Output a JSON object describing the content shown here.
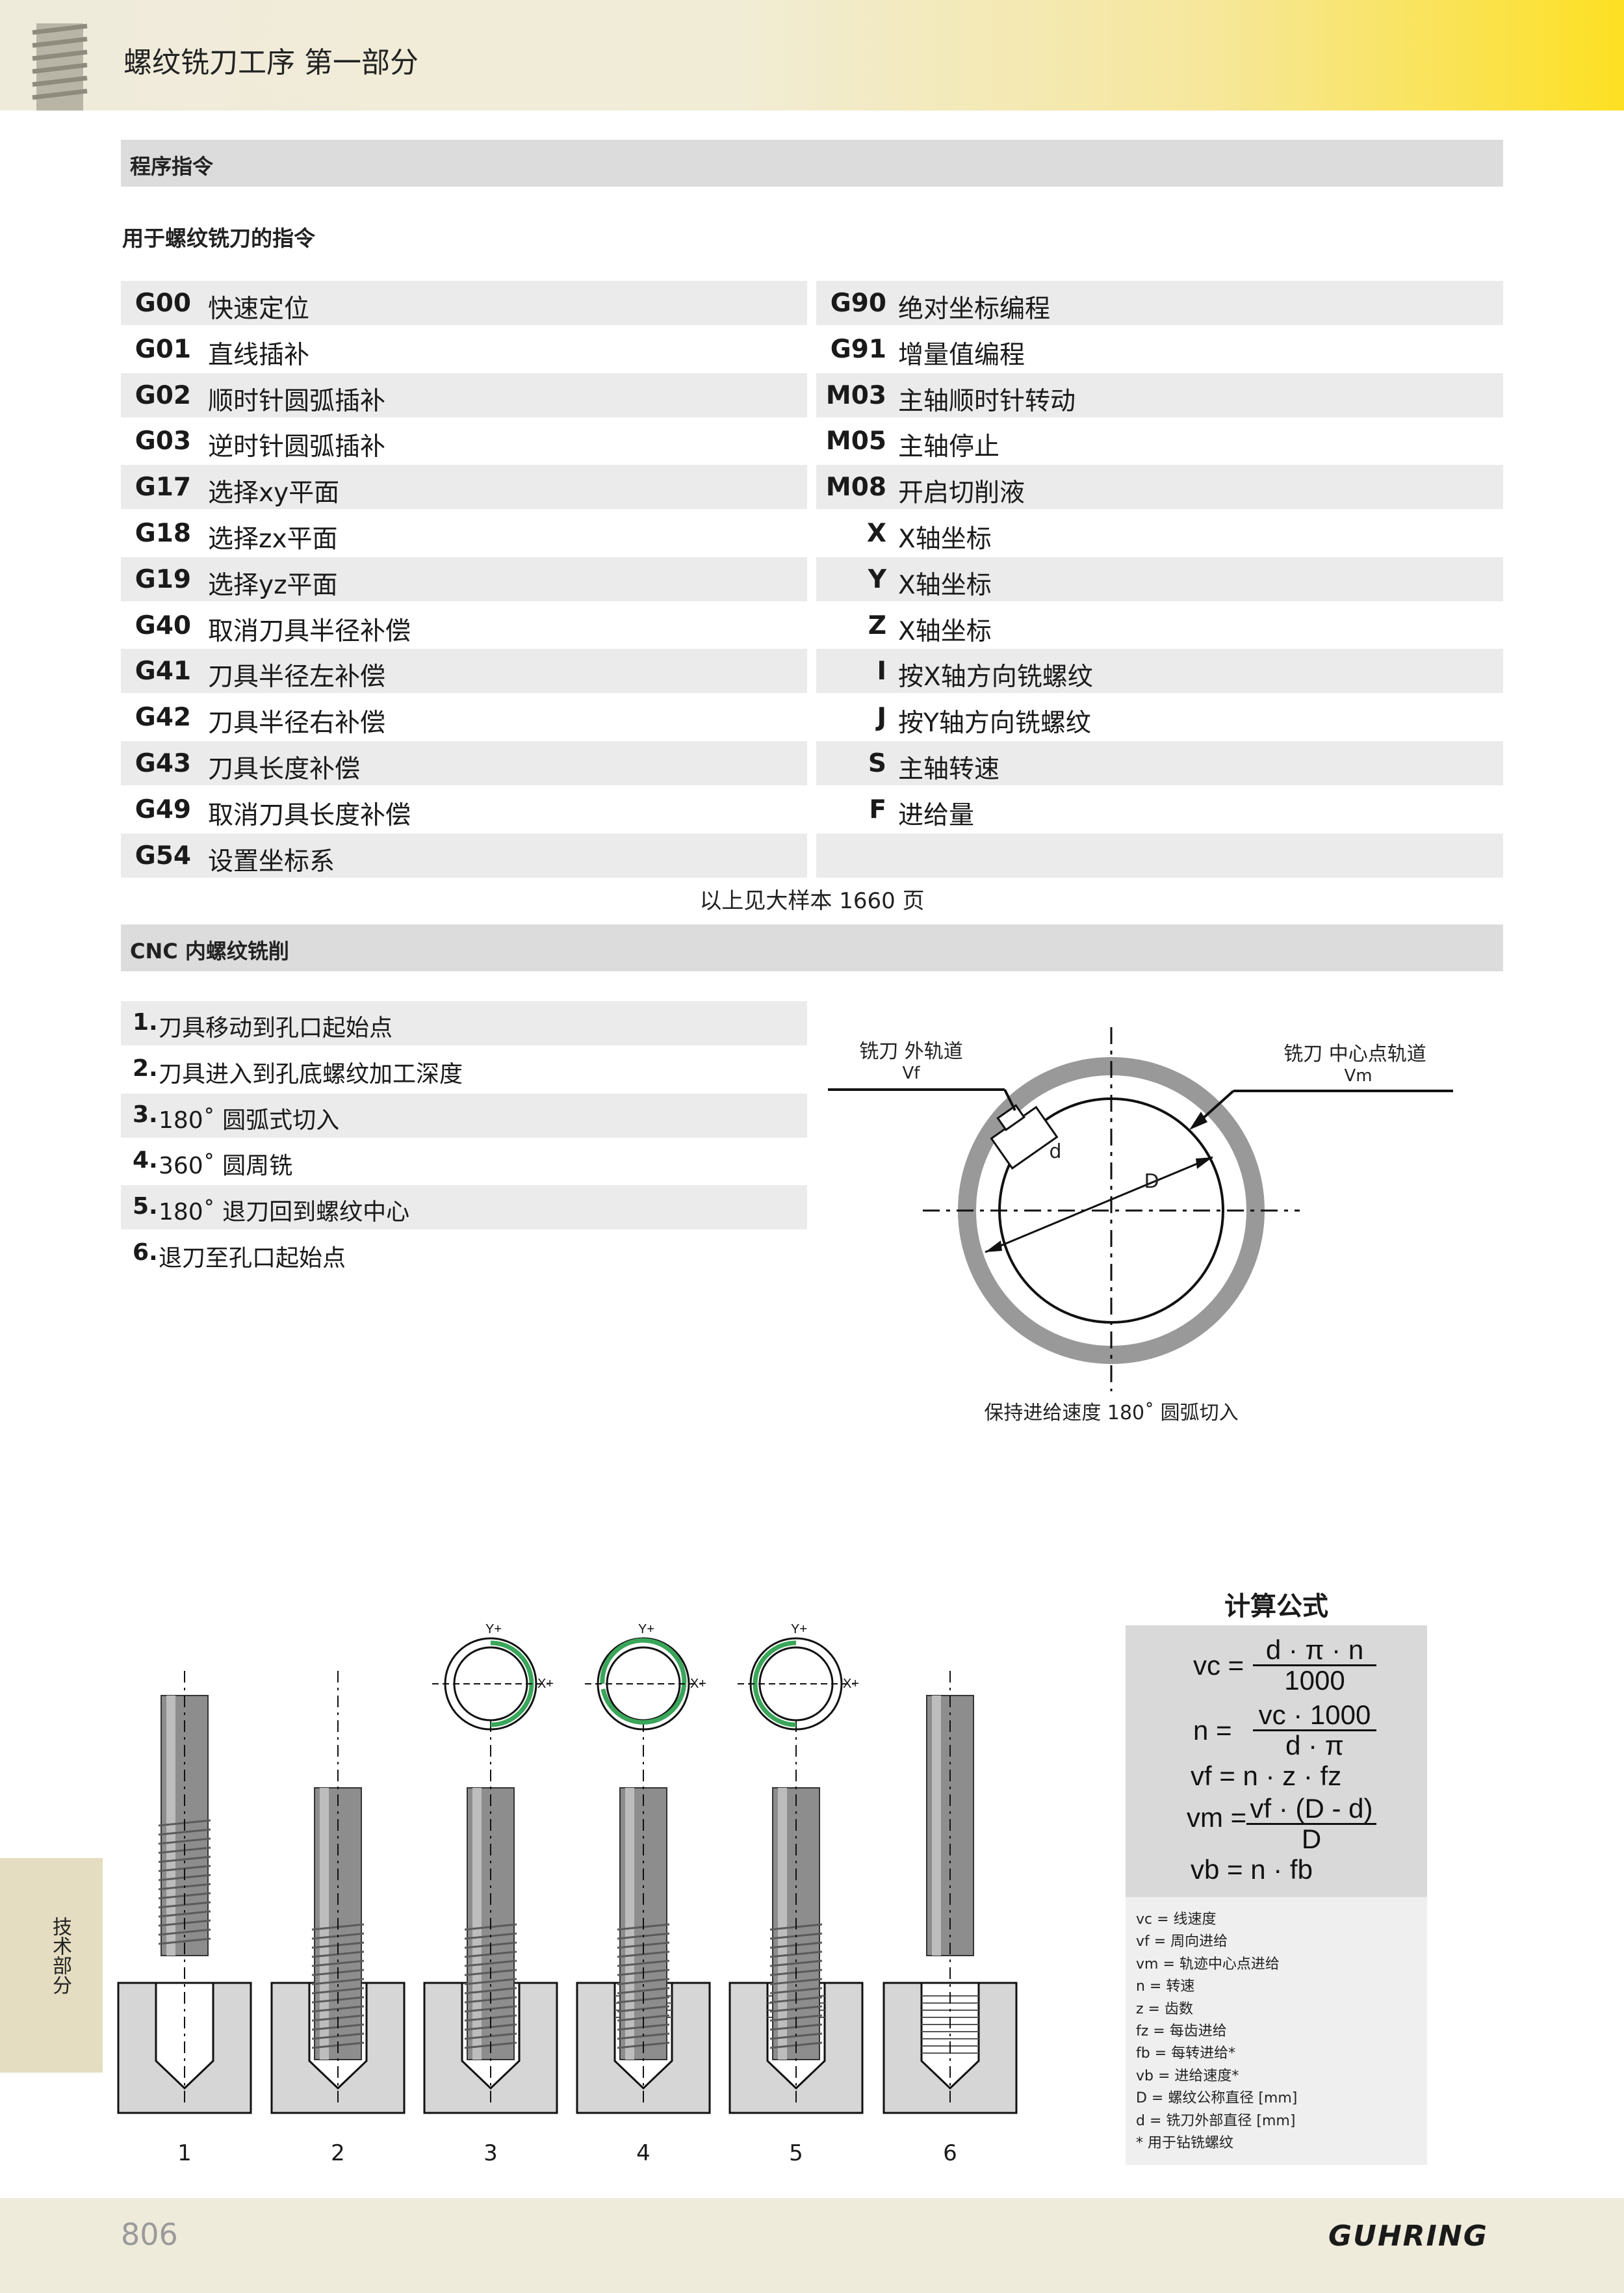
{
  "header": {
    "title": "螺纹铣刀工序   第一部分"
  },
  "section1": {
    "title": "程序指令",
    "subtitle": "用于螺纹铣刀的指令"
  },
  "commands_left": [
    {
      "code": "G00",
      "desc": "快速定位"
    },
    {
      "code": "G01",
      "desc": "直线插补"
    },
    {
      "code": "G02",
      "desc": "顺时针圆弧插补"
    },
    {
      "code": "G03",
      "desc": "逆时针圆弧插补"
    },
    {
      "code": "G17",
      "desc": "选择xy平面"
    },
    {
      "code": "G18",
      "desc": "选择zx平面"
    },
    {
      "code": "G19",
      "desc": "选择yz平面"
    },
    {
      "code": "G40",
      "desc": "取消刀具半径补偿"
    },
    {
      "code": "G41",
      "desc": "刀具半径左补偿"
    },
    {
      "code": "G42",
      "desc": "刀具半径右补偿"
    },
    {
      "code": "G43",
      "desc": "刀具长度补偿"
    },
    {
      "code": "G49",
      "desc": "取消刀具长度补偿"
    },
    {
      "code": "G54",
      "desc": "设置坐标系"
    }
  ],
  "commands_right": [
    {
      "code": "G90",
      "desc": "绝对坐标编程"
    },
    {
      "code": "G91",
      "desc": "增量值编程"
    },
    {
      "code": "M03",
      "desc": "主轴顺时针转动"
    },
    {
      "code": "M05",
      "desc": "主轴停止"
    },
    {
      "code": "M08",
      "desc": "开启切削液"
    },
    {
      "code": "X",
      "desc": "X轴坐标"
    },
    {
      "code": "Y",
      "desc": "X轴坐标"
    },
    {
      "code": "Z",
      "desc": "X轴坐标"
    },
    {
      "code": "I",
      "desc": "按X轴方向铣螺纹"
    },
    {
      "code": "J",
      "desc": "按Y轴方向铣螺纹"
    },
    {
      "code": "S",
      "desc": "主轴转速"
    },
    {
      "code": "F",
      "desc": "进给量"
    },
    {
      "code": "",
      "desc": ""
    }
  ],
  "reference_note": "以上见大样本 1660 页",
  "section2": {
    "title": "CNC 内螺纹铣削"
  },
  "steps": [
    {
      "num": "1.",
      "text": "刀具移动到孔口起始点"
    },
    {
      "num": "2.",
      "text": "刀具进入到孔底螺纹加工深度"
    },
    {
      "num": "3.",
      "text": "180˚ 圆弧式切入"
    },
    {
      "num": "4.",
      "text": "360˚ 圆周铣"
    },
    {
      "num": "5.",
      "text": "180˚ 退刀回到螺纹中心"
    },
    {
      "num": "6.",
      "text": "退刀至孔口起始点"
    }
  ],
  "diagram": {
    "outer_label": "铣刀 外轨道",
    "outer_sub": "Vf",
    "center_label": "铣刀 中心点轨道",
    "center_sub": "Vm",
    "d_label": "d",
    "D_label": "D",
    "caption": "保持进给速度 180˚ 圆弧切入",
    "colors": {
      "ring": "#999999",
      "path": "#3aa65a"
    }
  },
  "tool_sequence": {
    "axis_y": "Y+",
    "axis_x": "X+",
    "labels": [
      "1",
      "2",
      "3",
      "4",
      "5",
      "6"
    ]
  },
  "formulas": {
    "title": "计算公式",
    "vc": {
      "lhs": "vc =",
      "num": "d · π · n",
      "den": "1000"
    },
    "n": {
      "lhs": "n =",
      "num": "vc · 1000",
      "den": "d · π"
    },
    "vf": "vf = n · z · fz",
    "vm": {
      "lhs": "vm =",
      "num": "vf · (D - d)",
      "den": "D"
    },
    "vb": "vb = n · fb",
    "legend": [
      "vc  = 线速度",
      "vf  = 周向进给",
      "vm = 轨迹中心点进给",
      "n   = 转速",
      "z   = 齿数",
      "fz  = 每齿进给",
      "fb  = 每转进给*",
      "vb  = 进给速度*",
      "D   = 螺纹公称直径 [mm]",
      "d   = 铣刀外部直径 [mm]",
      "* 用于钻铣螺纹"
    ]
  },
  "side_tab": "技术部分",
  "footer": {
    "page_number": "806",
    "brand": "GUHRING"
  }
}
